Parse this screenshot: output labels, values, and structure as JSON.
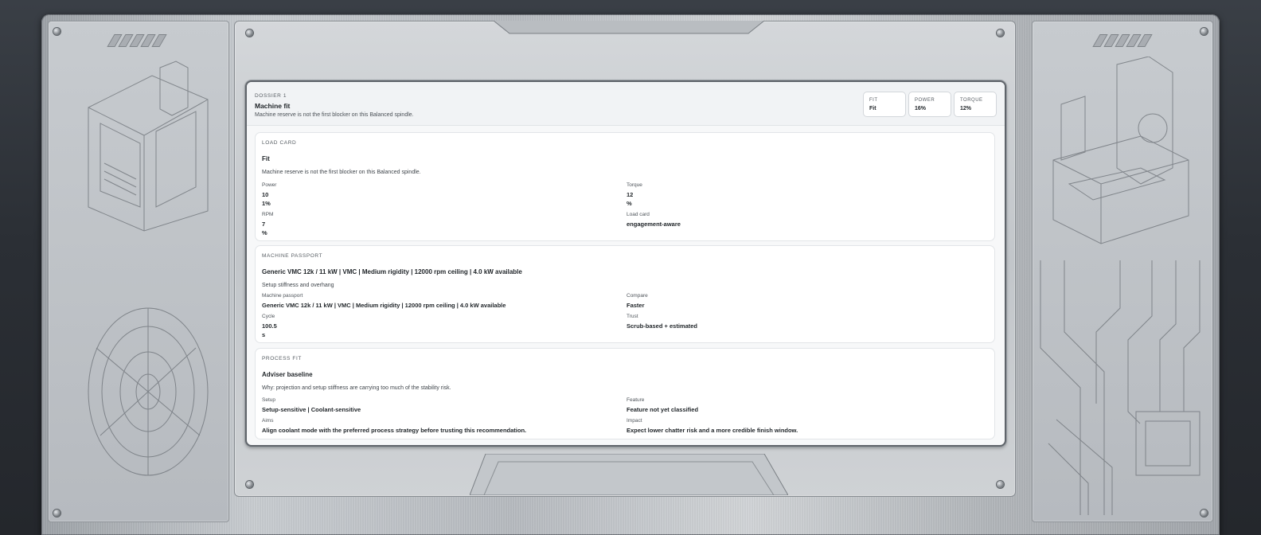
{
  "header": {
    "kicker": "DOSSIER 1",
    "title": "Machine fit",
    "subtitle": "Machine reserve is not the first blocker on this Balanced spindle.",
    "stats": [
      {
        "label": "FIT",
        "value": "Fit"
      },
      {
        "label": "POWER",
        "value": "16%"
      },
      {
        "label": "TORQUE",
        "value": "12%"
      }
    ]
  },
  "load_card": {
    "kicker": "LOAD CARD",
    "title": "Fit",
    "description": "Machine reserve is not the first blocker on this Balanced spindle.",
    "power_label": "Power",
    "power_value_1": "10",
    "power_value_2": "1%",
    "torque_label": "Torque",
    "torque_value_1": "12",
    "torque_value_2": "%",
    "rpm_label": "RPM",
    "rpm_value_1": "7",
    "rpm_value_2": "%",
    "load_label": "Load card",
    "load_value": "engagement-aware"
  },
  "machine_passport": {
    "kicker": "MACHINE PASSPORT",
    "title": "Generic VMC 12k / 11 kW | VMC | Medium rigidity | 12000 rpm ceiling | 4.0 kW available",
    "description": "Setup stiffness and overhang",
    "passport_label": "Machine passport",
    "passport_value": "Generic VMC 12k / 11 kW | VMC | Medium rigidity | 12000 rpm ceiling | 4.0 kW available",
    "compare_label": "Compare",
    "compare_value": "Faster",
    "cycle_label": "Cycle",
    "cycle_value_1": "100.5",
    "cycle_value_2": "s",
    "trust_label": "Trust",
    "trust_value": "Scrub-based + estimated"
  },
  "process_fit": {
    "kicker": "PROCESS FIT",
    "title": "Adviser baseline",
    "description": "Why: projection and setup stiffness are carrying too much of the stability risk.",
    "setup_label": "Setup",
    "setup_value": "Setup-sensitive | Coolant-sensitive",
    "feature_label": "Feature",
    "feature_value": "Feature not yet classified",
    "aims_label": "Aims",
    "aims_value": "Align coolant mode with the preferred process strategy before trusting this recommendation.",
    "impact_label": "Impact",
    "impact_value": "Expect lower chatter risk and a more credible finish window."
  }
}
